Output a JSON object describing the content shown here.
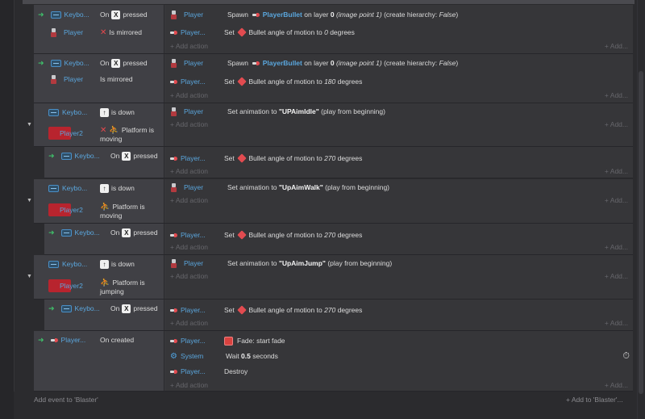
{
  "events": [
    {
      "conditions": [
        {
          "object": "Keybo...",
          "text_before": "On",
          "key": "X",
          "text_after": "pressed"
        },
        {
          "object": "Player",
          "text": "Is mirrored",
          "inverted": true
        }
      ],
      "actions": [
        {
          "object": "Player",
          "parts": [
            "Spawn",
            "PlayerBullet",
            "on layer",
            "0",
            "(image point 1)",
            "(create hierarchy:",
            "False",
            ")"
          ]
        },
        {
          "object": "Player...",
          "parts": [
            "Set",
            "Bullet angle of motion to",
            "0",
            "degrees"
          ]
        }
      ]
    },
    {
      "conditions": [
        {
          "object": "Keybo...",
          "text_before": "On",
          "key": "X",
          "text_after": "pressed"
        },
        {
          "object": "Player",
          "text": "Is mirrored"
        }
      ],
      "actions": [
        {
          "object": "Player",
          "parts": [
            "Spawn",
            "PlayerBullet",
            "on layer",
            "0",
            "(image point 1)",
            "(create hierarchy:",
            "False",
            ")"
          ]
        },
        {
          "object": "Player...",
          "parts": [
            "Set",
            "Bullet angle of motion to",
            "180",
            "degrees"
          ]
        }
      ]
    },
    {
      "conditions": [
        {
          "object": "Keybo...",
          "text": "is down"
        },
        {
          "object": "Player2",
          "text": "Platform is",
          "text2": "moving"
        }
      ],
      "actions": [
        {
          "object": "Player",
          "parts": [
            "Set animation to",
            "\"UPAimIdle\"",
            "(play from beginning)"
          ]
        }
      ],
      "sub": {
        "condition": {
          "object": "Keybo...",
          "text_before": "On",
          "key": "X",
          "text_after": "pressed"
        },
        "action": {
          "object": "Player...",
          "parts": [
            "Set",
            "Bullet angle of motion to",
            "270",
            "degrees"
          ]
        }
      }
    },
    {
      "conditions": [
        {
          "object": "Keybo...",
          "text": "is down"
        },
        {
          "object": "Player2",
          "text": "Platform is",
          "text2": "moving"
        }
      ],
      "actions": [
        {
          "object": "Player",
          "parts": [
            "Set animation to",
            "\"UpAimWalk\"",
            "(play from beginning)"
          ]
        }
      ],
      "sub": {
        "condition": {
          "object": "Keybo...",
          "text_before": "On",
          "key": "X",
          "text_after": "pressed"
        },
        "action": {
          "object": "Player...",
          "parts": [
            "Set",
            "Bullet angle of motion to",
            "270",
            "degrees"
          ]
        }
      }
    },
    {
      "conditions": [
        {
          "object": "Keybo...",
          "text": "is down"
        },
        {
          "object": "Player2",
          "text": "Platform is",
          "text2": "jumping"
        }
      ],
      "actions": [
        {
          "object": "Player",
          "parts": [
            "Set animation to",
            "\"UpAimJump\"",
            "(play from beginning)"
          ]
        }
      ],
      "sub": {
        "condition": {
          "object": "Keybo...",
          "text_before": "On",
          "key": "X",
          "text_after": "pressed"
        },
        "action": {
          "object": "Player...",
          "parts": [
            "Set",
            "Bullet angle of motion to",
            "270",
            "degrees"
          ]
        }
      }
    },
    {
      "conditions": [
        {
          "object": "Player...",
          "text": "On created"
        }
      ],
      "actions": [
        {
          "object": "Player...",
          "parts": [
            "Fade: start fade"
          ]
        },
        {
          "object": "System",
          "parts": [
            "Wait",
            "0.5",
            "seconds"
          ]
        },
        {
          "object": "Player...",
          "parts": [
            "Destroy"
          ]
        }
      ]
    }
  ],
  "labels": {
    "add_action": "+ Add action",
    "add_more": "+ Add...",
    "add_event": "Add event to 'Blaster'",
    "add_to": "+ Add to 'Blaster'..."
  },
  "colors": {
    "object": "#5aa6dd",
    "accent_red": "#b8242e",
    "condition_arrow": "#3fbf6a"
  }
}
